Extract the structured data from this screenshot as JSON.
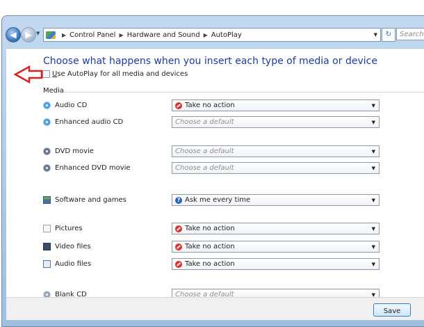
{
  "address_bar": {
    "breadcrumbs": [
      "Control Panel",
      "Hardware and Sound",
      "AutoPlay"
    ],
    "search_placeholder": "Search C"
  },
  "content": {
    "heading": "Choose what happens when you insert each type of media or device",
    "autoplay_checkbox": {
      "label_underlined": "U",
      "label_rest": "se AutoPlay for all media and devices",
      "checked": false
    },
    "section_label": "Media"
  },
  "media": [
    {
      "label": "Audio CD",
      "icon": "audio-cd-icon",
      "value": "Take no action",
      "value_icon": "no-action-icon",
      "placeholder": false
    },
    {
      "label": "Enhanced audio CD",
      "icon": "enhanced-audio-cd-icon",
      "value": "Choose a default",
      "value_icon": "",
      "placeholder": true
    },
    {
      "label": "DVD movie",
      "icon": "dvd-movie-icon",
      "value": "Choose a default",
      "value_icon": "",
      "placeholder": true
    },
    {
      "label": "Enhanced DVD movie",
      "icon": "enhanced-dvd-movie-icon",
      "value": "Choose a default",
      "value_icon": "",
      "placeholder": true
    },
    {
      "label": "Software and games",
      "icon": "software-games-icon",
      "value": "Ask me every time",
      "value_icon": "ask-icon",
      "placeholder": false
    },
    {
      "label": "Pictures",
      "icon": "pictures-icon",
      "value": "Take no action",
      "value_icon": "no-action-icon",
      "placeholder": false
    },
    {
      "label": "Video files",
      "icon": "video-files-icon",
      "value": "Take no action",
      "value_icon": "no-action-icon",
      "placeholder": false
    },
    {
      "label": "Audio files",
      "icon": "audio-files-icon",
      "value": "Take no action",
      "value_icon": "no-action-icon",
      "placeholder": false
    },
    {
      "label": "Blank CD",
      "icon": "blank-cd-icon",
      "value": "Choose a default",
      "value_icon": "",
      "placeholder": true
    }
  ],
  "footer": {
    "save_label": "Save"
  },
  "colors": {
    "heading": "#1e3d9e",
    "arrow": "#e0201c",
    "frame": "#b4cde6"
  }
}
